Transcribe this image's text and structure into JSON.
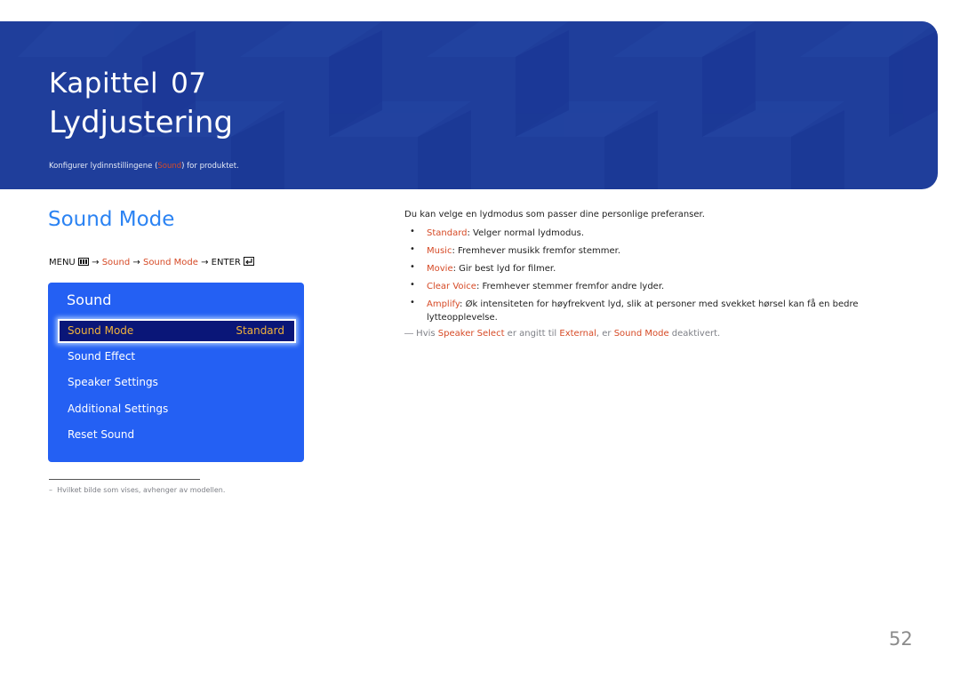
{
  "header": {
    "chapter_label": "Kapittel",
    "chapter_number": "07",
    "chapter_title": "Lydjustering",
    "description_before": "Konfigurer lydinnstillingene (",
    "description_highlight": "Sound",
    "description_after": ") for produktet."
  },
  "section": {
    "title": "Sound Mode",
    "menu_path": {
      "menu": "MENU",
      "menu_icon": "menu-grid-icon",
      "arrow": "→",
      "step1": "Sound",
      "step2": "Sound Mode",
      "enter": "ENTER",
      "enter_icon": "enter-icon"
    }
  },
  "osd_menu": {
    "title": "Sound",
    "selected_item": {
      "label": "Sound Mode",
      "value": "Standard"
    },
    "items": [
      "Sound Effect",
      "Speaker Settings",
      "Additional Settings",
      "Reset Sound"
    ]
  },
  "footnote": {
    "dash": "–",
    "text": "Hvilket bilde som vises, avhenger av modellen."
  },
  "content": {
    "intro": "Du kan velge en lydmodus som passer dine personlige preferanser.",
    "bullets": [
      {
        "term": "Standard",
        "desc": ": Velger normal lydmodus."
      },
      {
        "term": "Music",
        "desc": ": Fremhever musikk fremfor stemmer."
      },
      {
        "term": "Movie",
        "desc": ": Gir best lyd for filmer."
      },
      {
        "term": "Clear Voice",
        "desc": ": Fremhever stemmer fremfor andre lyder."
      },
      {
        "term": "Amplify",
        "desc": ": Øk intensiteten for høyfrekvent lyd, slik at personer med svekket hørsel kan få en bedre lytteopplevelse."
      }
    ],
    "note": {
      "mark": "―",
      "p1": " Hvis ",
      "h1": "Speaker Select",
      "p2": " er angitt til ",
      "h2": "External",
      "p3": ", er ",
      "h3": "Sound Mode",
      "p4": " deaktivert."
    }
  },
  "page_number": "52",
  "colors": {
    "banner_blue": "#1f3e9b",
    "accent_red": "#d64a26",
    "heading_blue": "#2b83f3",
    "osd_blue": "#2460f3",
    "osd_selected_bg": "#0a1678",
    "osd_selected_text": "#f0b23b"
  }
}
